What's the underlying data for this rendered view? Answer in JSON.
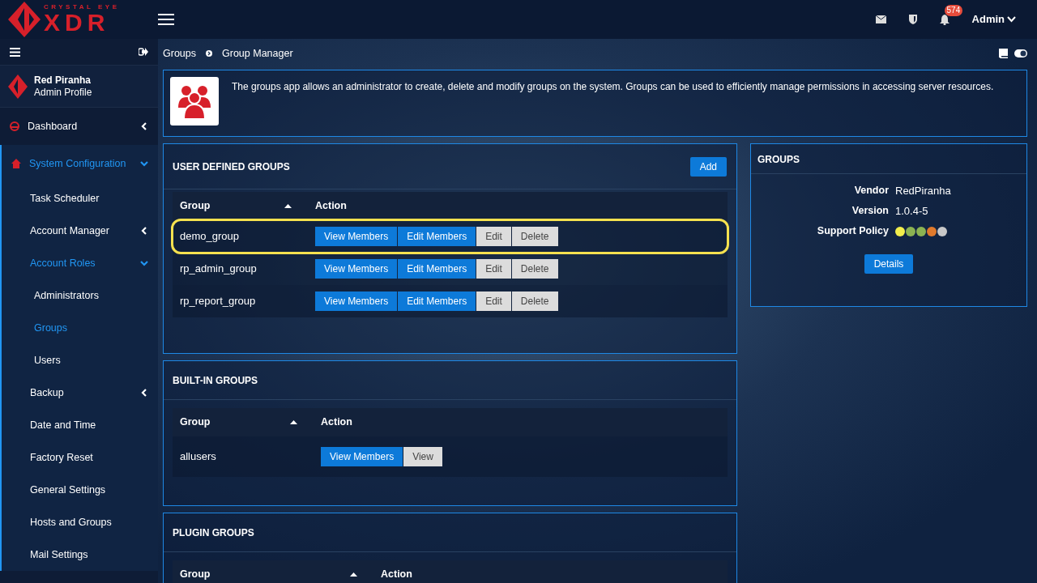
{
  "logo": {
    "tagline": "CRYSTAL EYE",
    "name": "XDR"
  },
  "topbar": {
    "notification_count": "574",
    "user": "Admin"
  },
  "profile": {
    "name": "Red Piranha",
    "role": "Admin Profile"
  },
  "sidebar": {
    "items": [
      {
        "label": "Dashboard",
        "selected": false,
        "expanded": false
      },
      {
        "label": "System Configuration",
        "selected": true,
        "expanded": true,
        "children": [
          {
            "label": "Task Scheduler",
            "selected": false
          },
          {
            "label": "Account Manager",
            "selected": false,
            "expanded": false
          },
          {
            "label": "Account Roles",
            "selected": true,
            "expanded": true,
            "children": [
              {
                "label": "Administrators",
                "selected": false
              },
              {
                "label": "Groups",
                "selected": true
              },
              {
                "label": "Users",
                "selected": false
              }
            ]
          },
          {
            "label": "Backup",
            "selected": false,
            "expanded": false
          },
          {
            "label": "Date and Time",
            "selected": false
          },
          {
            "label": "Factory Reset",
            "selected": false
          },
          {
            "label": "General Settings",
            "selected": false
          },
          {
            "label": "Hosts and Groups",
            "selected": false
          },
          {
            "label": "Mail Settings",
            "selected": false
          }
        ]
      }
    ]
  },
  "breadcrumb": [
    "Groups",
    "Group Manager"
  ],
  "intro": "The groups app allows an administrator to create, delete and modify groups on the system. Groups can be used to efficiently manage permissions in accessing server resources.",
  "sections": [
    {
      "title": "USER DEFINED GROUPS",
      "add_button": "Add",
      "columns": [
        "Group",
        "Action"
      ],
      "rows": [
        {
          "group": "demo_group",
          "highlighted": true,
          "buttons": [
            {
              "label": "View Members",
              "kind": "primary"
            },
            {
              "label": "Edit Members",
              "kind": "primary"
            },
            {
              "label": "Edit",
              "kind": "secondary"
            },
            {
              "label": "Delete",
              "kind": "secondary"
            }
          ]
        },
        {
          "group": "rp_admin_group",
          "highlighted": false,
          "buttons": [
            {
              "label": "View Members",
              "kind": "primary"
            },
            {
              "label": "Edit Members",
              "kind": "primary"
            },
            {
              "label": "Edit",
              "kind": "secondary"
            },
            {
              "label": "Delete",
              "kind": "secondary"
            }
          ]
        },
        {
          "group": "rp_report_group",
          "highlighted": false,
          "buttons": [
            {
              "label": "View Members",
              "kind": "primary"
            },
            {
              "label": "Edit Members",
              "kind": "primary"
            },
            {
              "label": "Edit",
              "kind": "secondary"
            },
            {
              "label": "Delete",
              "kind": "secondary"
            }
          ]
        }
      ]
    },
    {
      "title": "BUILT-IN GROUPS",
      "columns": [
        "Group",
        "Action"
      ],
      "rows": [
        {
          "group": "allusers",
          "highlighted": false,
          "buttons": [
            {
              "label": "View Members",
              "kind": "primary"
            },
            {
              "label": "View",
              "kind": "secondary"
            }
          ]
        }
      ]
    },
    {
      "title": "PLUGIN GROUPS",
      "columns": [
        "Group",
        "Action"
      ]
    }
  ],
  "info_card": {
    "title": "GROUPS",
    "fields": [
      {
        "label": "Vendor",
        "value": "RedPiranha"
      },
      {
        "label": "Version",
        "value": "1.0.4-5"
      }
    ],
    "support_policy": {
      "label": "Support Policy",
      "dots": [
        {
          "color": "#f2ee4c"
        },
        {
          "color": "#8cb352"
        },
        {
          "color": "#8cb352"
        },
        {
          "color": "#e07a2c"
        },
        {
          "color": "#c8c8c8"
        }
      ]
    },
    "button": "Details"
  }
}
